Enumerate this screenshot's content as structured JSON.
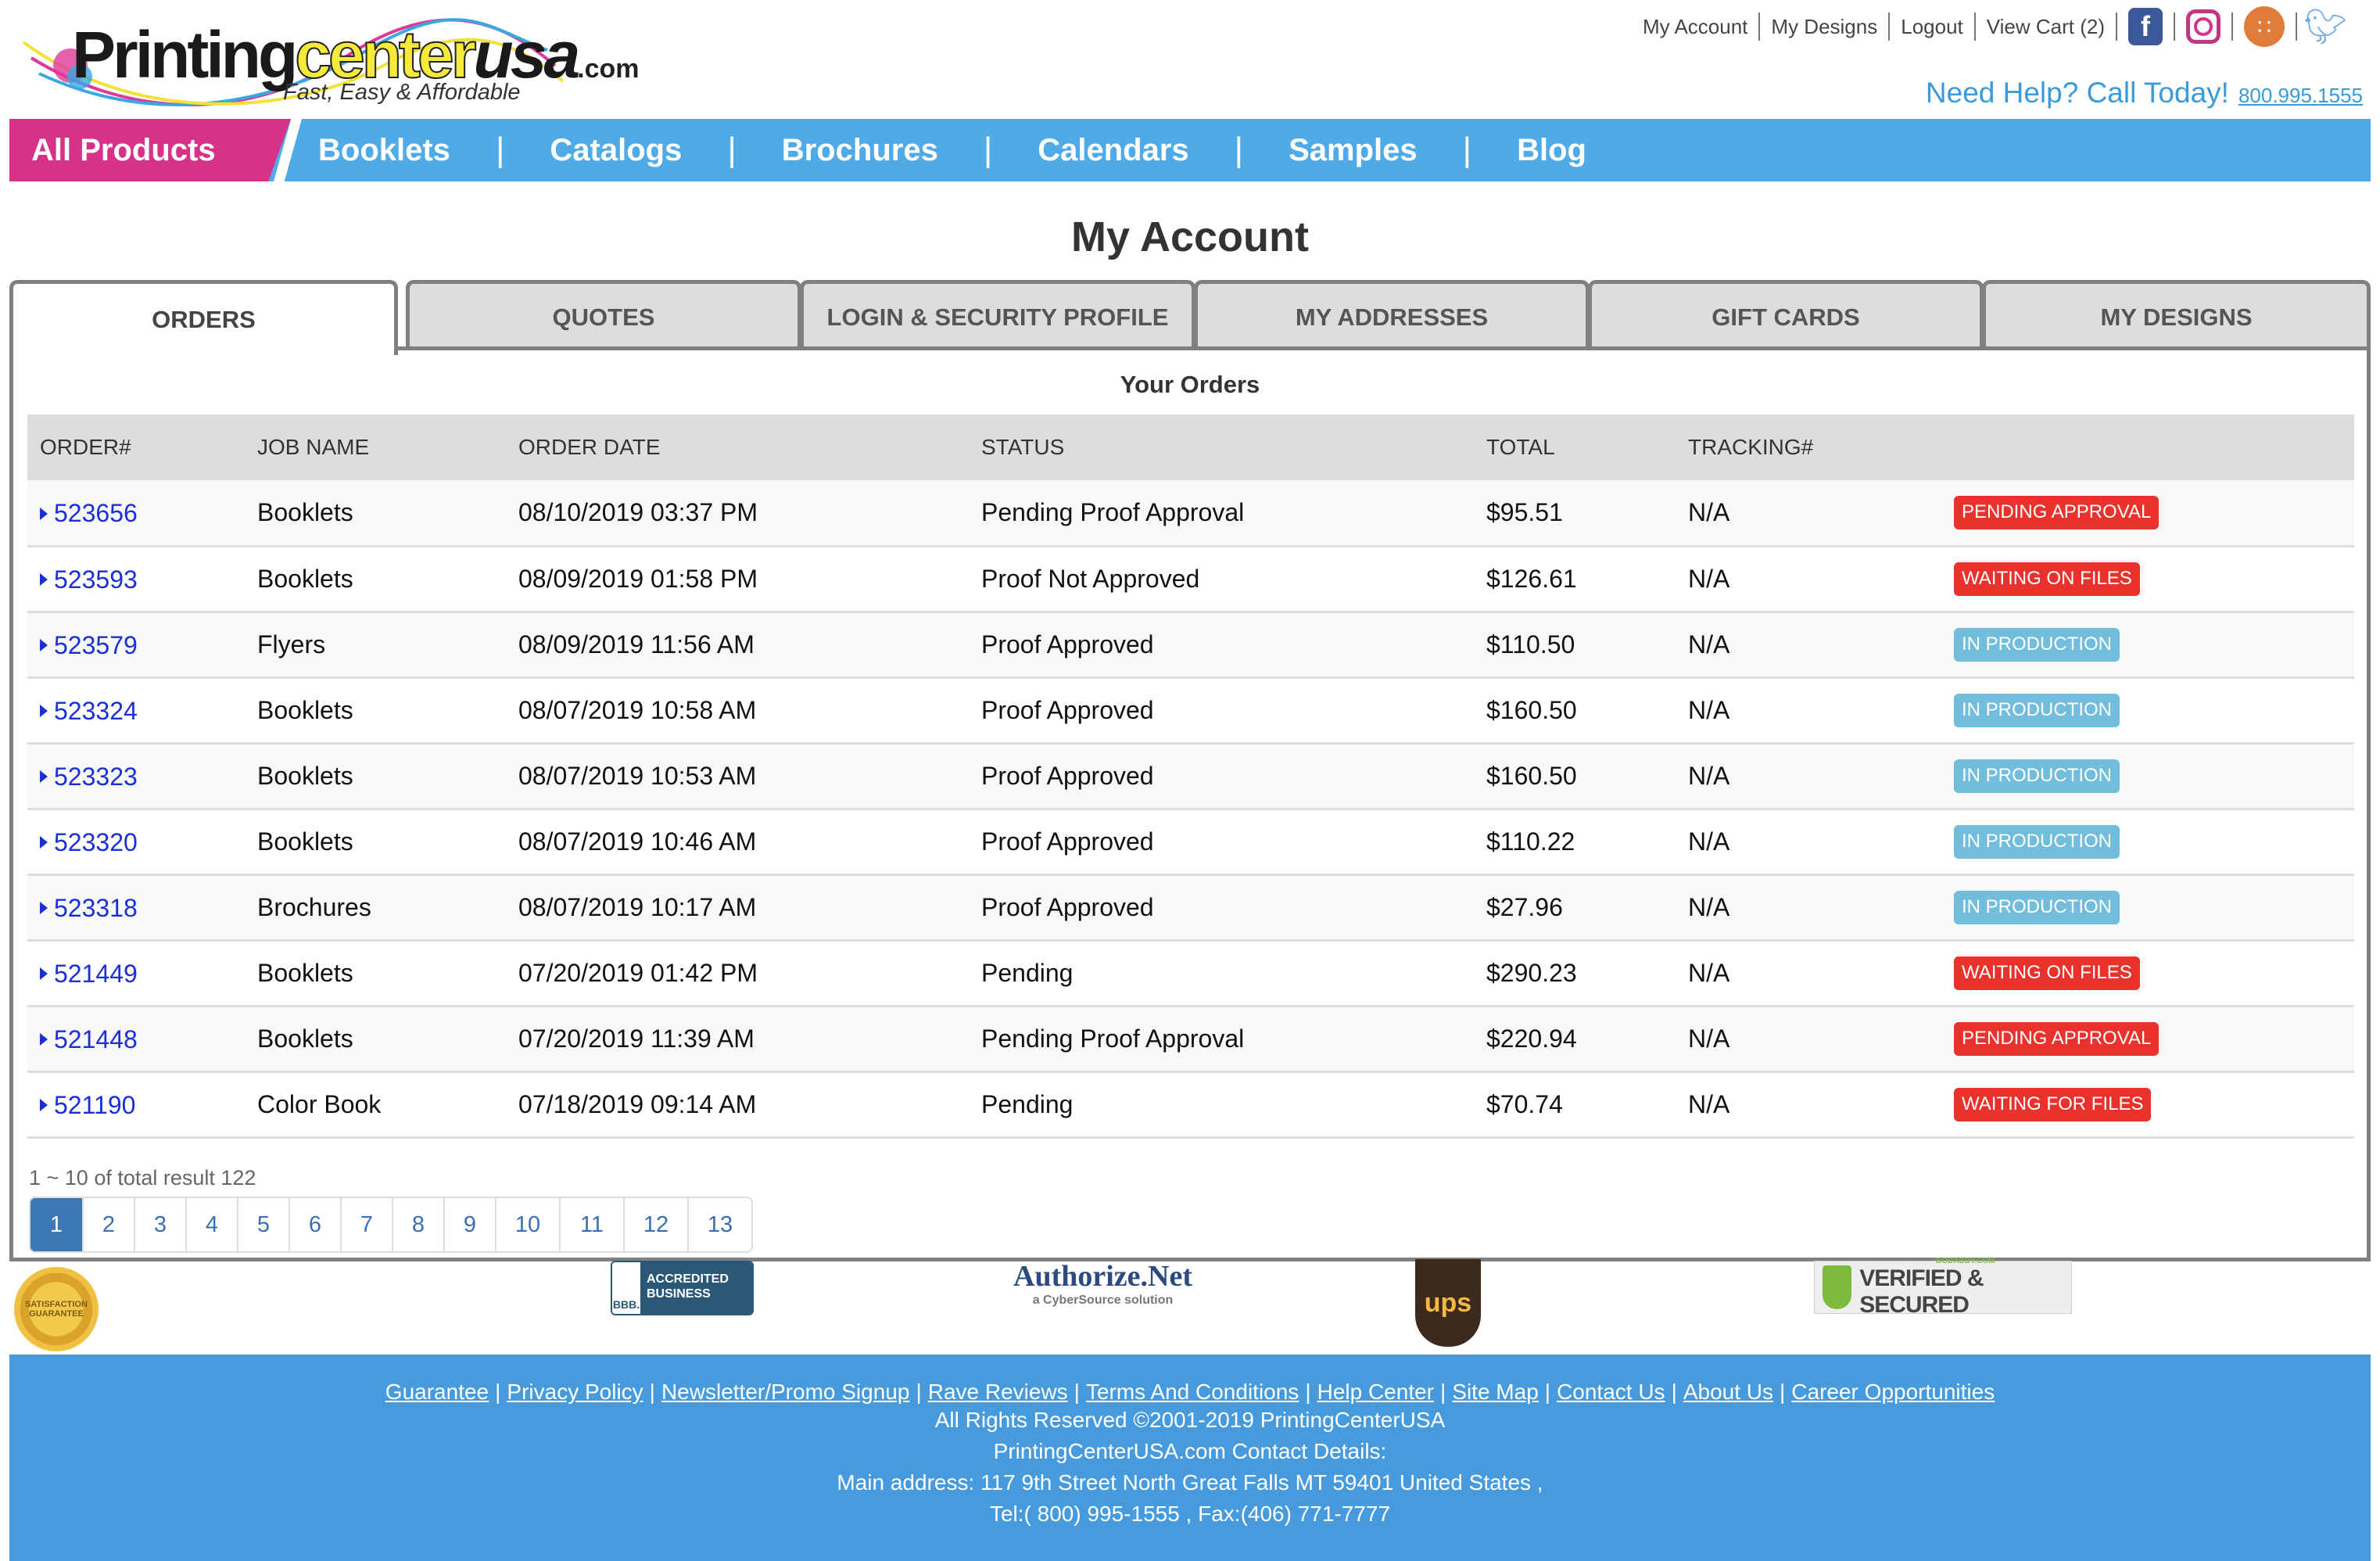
{
  "brand": {
    "name_part1": "Printing",
    "name_part2": "center",
    "name_part3": "usa",
    "name_suffix": ".com",
    "tagline": "Fast, Easy & Affordable"
  },
  "top_links": {
    "my_account": "My Account",
    "my_designs": "My Designs",
    "logout": "Logout",
    "view_cart": "View Cart (2)",
    "social": [
      "facebook-icon",
      "instagram-icon",
      "rss-icon",
      "twitter-icon"
    ]
  },
  "help": {
    "text": "Need Help? Call Today!",
    "phone": "800.995.1555"
  },
  "nav": {
    "all_products": "All Products",
    "items": [
      "Booklets",
      "Catalogs",
      "Brochures",
      "Calendars",
      "Samples",
      "Blog"
    ],
    "separator": "|"
  },
  "page_title": "My Account",
  "tabs": [
    {
      "label": "ORDERS",
      "active": true
    },
    {
      "label": "QUOTES",
      "active": false
    },
    {
      "label": "LOGIN & SECURITY PROFILE",
      "active": false
    },
    {
      "label": "MY ADDRESSES",
      "active": false
    },
    {
      "label": "GIFT CARDS",
      "active": false
    },
    {
      "label": "MY DESIGNS",
      "active": false
    }
  ],
  "orders": {
    "heading": "Your Orders",
    "columns": [
      "ORDER#",
      "JOB NAME",
      "ORDER DATE",
      "STATUS",
      "TOTAL",
      "TRACKING#",
      ""
    ],
    "rows": [
      {
        "order": "523656",
        "job": "Booklets",
        "date": "08/10/2019 03:37 PM",
        "status": "Pending Proof Approval",
        "total": "$95.51",
        "tracking": "N/A",
        "badge": "PENDING APPROVAL",
        "badge_color": "red"
      },
      {
        "order": "523593",
        "job": "Booklets",
        "date": "08/09/2019 01:58 PM",
        "status": "Proof Not Approved",
        "total": "$126.61",
        "tracking": "N/A",
        "badge": "WAITING ON FILES",
        "badge_color": "red"
      },
      {
        "order": "523579",
        "job": "Flyers",
        "date": "08/09/2019 11:56 AM",
        "status": "Proof Approved",
        "total": "$110.50",
        "tracking": "N/A",
        "badge": "IN PRODUCTION",
        "badge_color": "blue"
      },
      {
        "order": "523324",
        "job": "Booklets",
        "date": "08/07/2019 10:58 AM",
        "status": "Proof Approved",
        "total": "$160.50",
        "tracking": "N/A",
        "badge": "IN PRODUCTION",
        "badge_color": "blue"
      },
      {
        "order": "523323",
        "job": "Booklets",
        "date": "08/07/2019 10:53 AM",
        "status": "Proof Approved",
        "total": "$160.50",
        "tracking": "N/A",
        "badge": "IN PRODUCTION",
        "badge_color": "blue"
      },
      {
        "order": "523320",
        "job": "Booklets",
        "date": "08/07/2019 10:46 AM",
        "status": "Proof Approved",
        "total": "$110.22",
        "tracking": "N/A",
        "badge": "IN PRODUCTION",
        "badge_color": "blue"
      },
      {
        "order": "523318",
        "job": "Brochures",
        "date": "08/07/2019 10:17 AM",
        "status": "Proof Approved",
        "total": "$27.96",
        "tracking": "N/A",
        "badge": "IN PRODUCTION",
        "badge_color": "blue"
      },
      {
        "order": "521449",
        "job": "Booklets",
        "date": "07/20/2019 01:42 PM",
        "status": "Pending",
        "total": "$290.23",
        "tracking": "N/A",
        "badge": "WAITING ON FILES",
        "badge_color": "red"
      },
      {
        "order": "521448",
        "job": "Booklets",
        "date": "07/20/2019 11:39 AM",
        "status": "Pending Proof Approval",
        "total": "$220.94",
        "tracking": "N/A",
        "badge": "PENDING APPROVAL",
        "badge_color": "red"
      },
      {
        "order": "521190",
        "job": "Color Book",
        "date": "07/18/2019 09:14 AM",
        "status": "Pending",
        "total": "$70.74",
        "tracking": "N/A",
        "badge": "WAITING FOR FILES",
        "badge_color": "red"
      }
    ],
    "result_info": "1 ~ 10 of total result 122",
    "pages": [
      "1",
      "2",
      "3",
      "4",
      "5",
      "6",
      "7",
      "8",
      "9",
      "10",
      "11",
      "12",
      "13"
    ],
    "current_page": "1"
  },
  "trust_badges": {
    "seal": "SATISFACTION GUARANTEE",
    "bbb_left": "BBB.",
    "bbb_right": "ACCREDITED BUSINESS",
    "authnet_title": "Authorize.Net",
    "authnet_sub": "a CyberSource solution",
    "ups": "ups",
    "godaddy_small": "GODADDY.COM",
    "godaddy": "VERIFIED & SECURED"
  },
  "footer": {
    "links": [
      "Guarantee",
      "Privacy Policy",
      "Newsletter/Promo Signup",
      "Rave Reviews",
      "Terms And Conditions",
      "Help Center",
      "Site Map",
      "Contact Us",
      "About Us",
      "Career Opportunities"
    ],
    "copyright": "All Rights Reserved ©2001-2019 PrintingCenterUSA",
    "contact_heading": "PrintingCenterUSA.com Contact Details:",
    "address": "Main address: 117 9th Street North Great Falls MT 59401 United States ,",
    "phones": "Tel:( 800) 995-1555 , Fax:(406) 771-7777"
  },
  "colors": {
    "nav_blue": "#4eabe8",
    "nav_pink": "#d83188",
    "badge_red": "#e8322b",
    "badge_blue": "#72bcdc",
    "link_blue": "#1a2fd8",
    "footer_blue": "#479bdc"
  }
}
